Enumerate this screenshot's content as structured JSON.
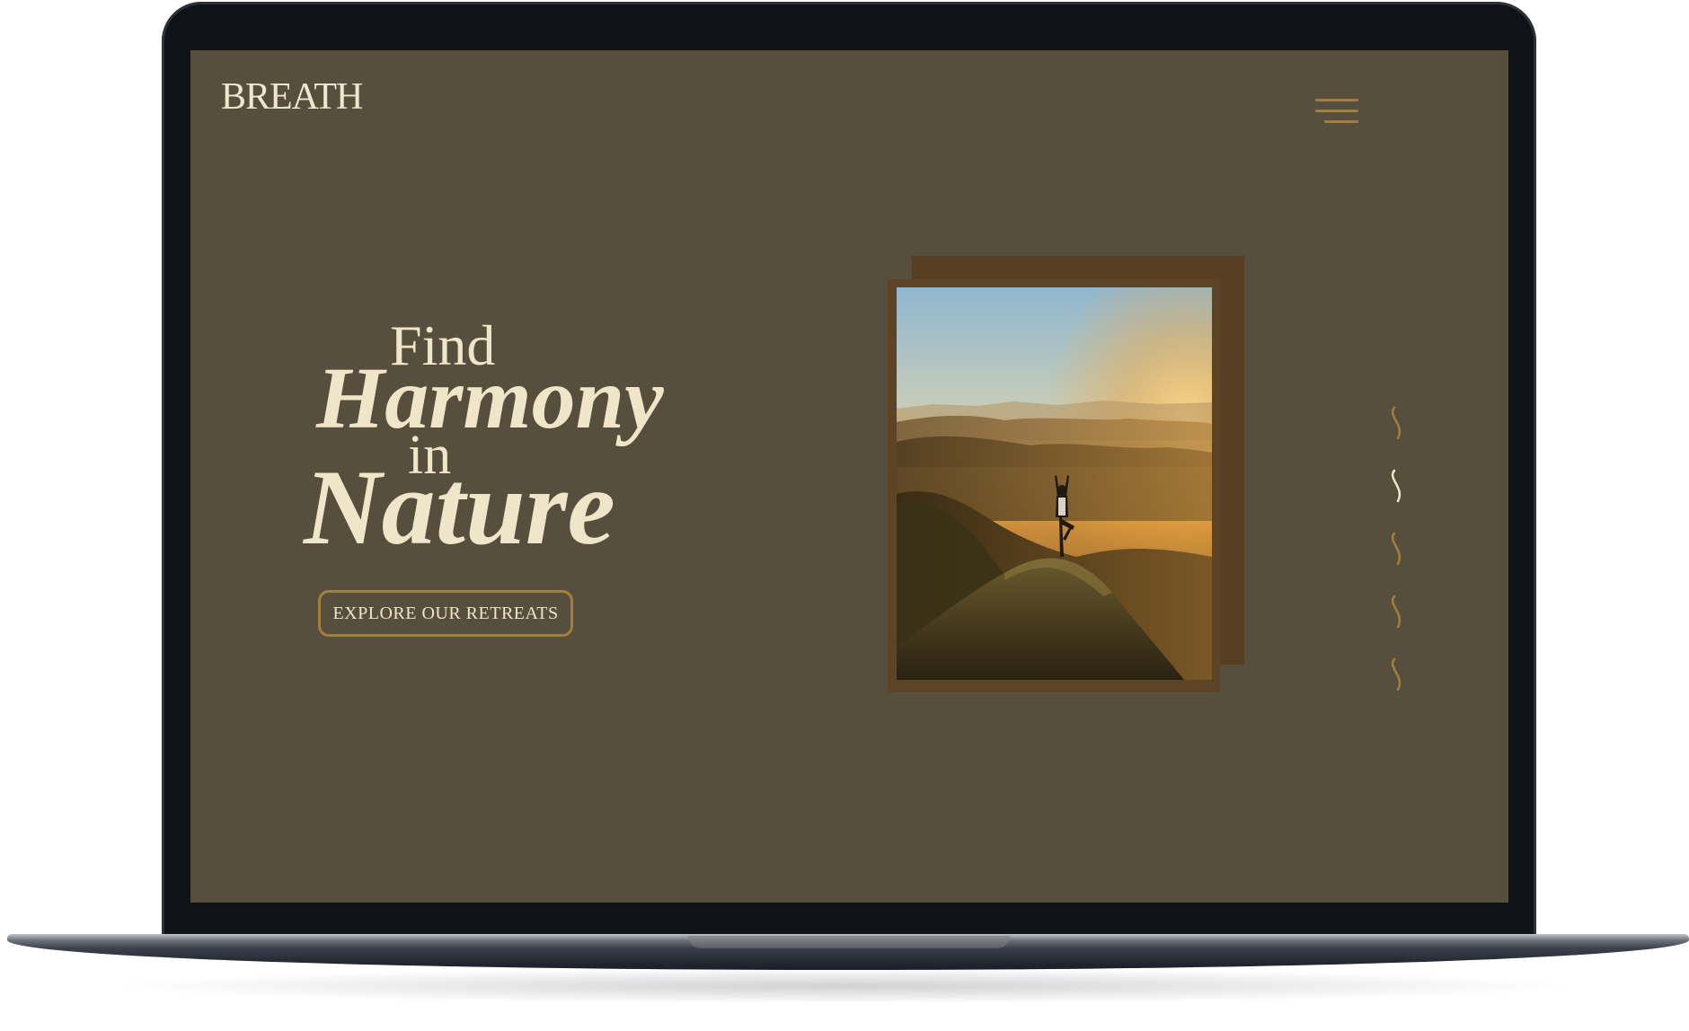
{
  "brand": {
    "logo_text": "BREATH"
  },
  "header": {
    "menu_icon": "hamburger-menu-icon"
  },
  "hero": {
    "line1": "Find",
    "line2": "Harmony",
    "line3": "in",
    "line4": "Nature",
    "cta_label": "EXPLORE OUR RETREATS"
  },
  "slider": {
    "dot_icon": "wave-squiggle-icon",
    "active_index": 1,
    "count": 5
  },
  "colors": {
    "background": "#574f3d",
    "text": "#efe5c8",
    "accent": "#a47e3c",
    "frame": "#5d4426",
    "device": "#0f1317"
  }
}
